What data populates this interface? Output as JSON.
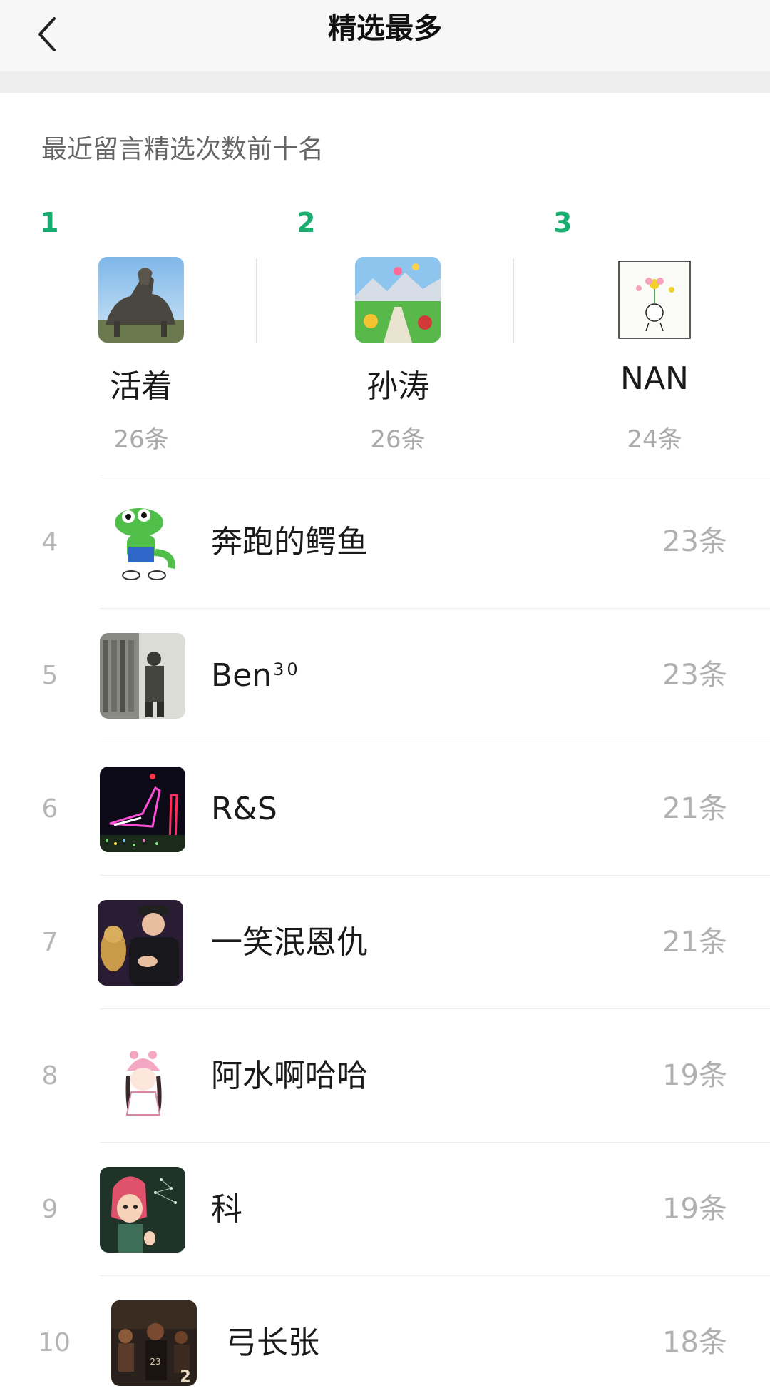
{
  "header": {
    "title": "精选最多",
    "back_icon": "chevron-left-icon"
  },
  "subtitle": "最近留言精选次数前十名",
  "colors": {
    "rank_accent": "#1aad70",
    "muted": "#aaaaaa"
  },
  "top3": [
    {
      "rank": "1",
      "name": "活着",
      "count": "26条"
    },
    {
      "rank": "2",
      "name": "孙涛",
      "count": "26条"
    },
    {
      "rank": "3",
      "name": "NAN",
      "count": "24条"
    }
  ],
  "list": [
    {
      "rank": "4",
      "name": "奔跑的鳄鱼",
      "count": "23条"
    },
    {
      "rank": "5",
      "name": "Ben",
      "name_sup": "30",
      "count": "23条"
    },
    {
      "rank": "6",
      "name": "R&S",
      "count": "21条"
    },
    {
      "rank": "7",
      "name": "一笑泯恩仇",
      "count": "21条"
    },
    {
      "rank": "8",
      "name": "阿水啊哈哈",
      "count": "19条"
    },
    {
      "rank": "9",
      "name": "科",
      "count": "19条"
    },
    {
      "rank": "10",
      "name": "弓长张",
      "count": "18条"
    }
  ]
}
